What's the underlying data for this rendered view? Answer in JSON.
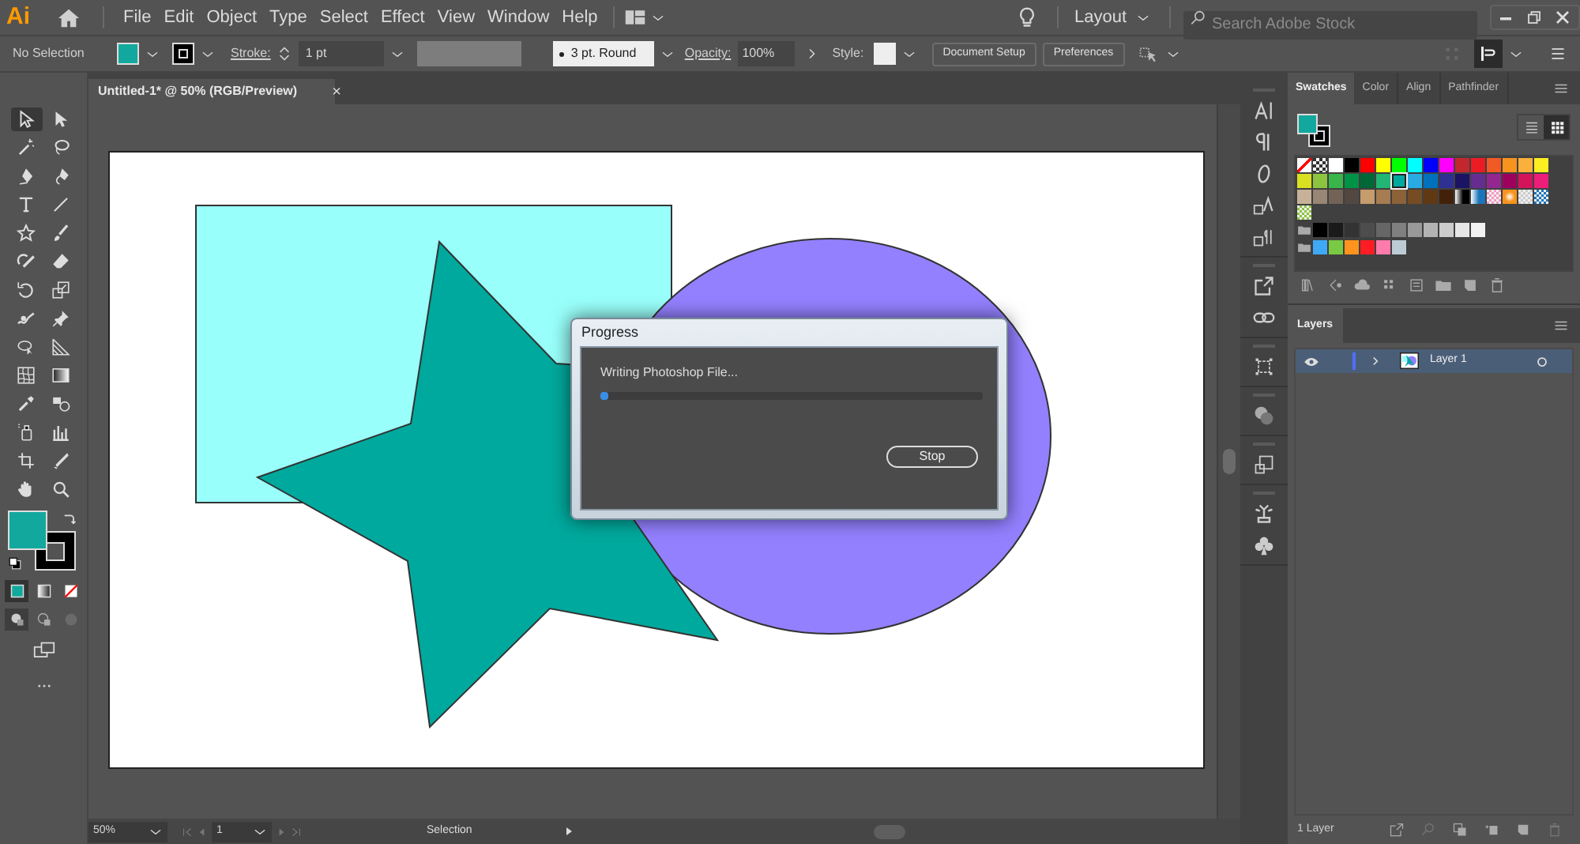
{
  "app": {
    "logo": "Ai"
  },
  "menu": [
    "File",
    "Edit",
    "Object",
    "Type",
    "Select",
    "Effect",
    "View",
    "Window",
    "Help"
  ],
  "workspace": {
    "label": "Layout"
  },
  "search": {
    "placeholder": "Search Adobe Stock"
  },
  "control_bar": {
    "selection": "No Selection",
    "stroke_label": "Stroke:",
    "stroke_weight": "1 pt",
    "brush": "3 pt. Round",
    "opacity_label": "Opacity:",
    "opacity": "100%",
    "style_label": "Style:",
    "buttons": [
      "Document Setup",
      "Preferences"
    ]
  },
  "document_tab": {
    "title": "Untitled-1* @ 50% (RGB/Preview)",
    "close": "×"
  },
  "tools": [
    {
      "selected": true
    },
    {
      "selected": false
    },
    {
      "selected": false
    },
    {
      "selected": false
    },
    {
      "selected": false
    },
    {
      "selected": false
    },
    {
      "selected": false
    },
    {
      "selected": false
    },
    {
      "selected": false
    },
    {
      "selected": false
    },
    {
      "selected": false
    },
    {
      "selected": false
    },
    {
      "selected": false
    },
    {
      "selected": false
    },
    {
      "selected": false
    },
    {
      "selected": false
    },
    {
      "selected": false
    },
    {
      "selected": false
    },
    {
      "selected": false
    },
    {
      "selected": false
    },
    {
      "selected": false
    },
    {
      "selected": false
    },
    {
      "selected": false
    },
    {
      "selected": false
    },
    {
      "selected": false
    },
    {
      "selected": false
    },
    {
      "selected": false
    },
    {
      "selected": false
    }
  ],
  "color_modes": [
    {
      "selected": true
    },
    {
      "selected": false
    },
    {
      "selected": false
    }
  ],
  "draw_modes": [
    {
      "selected": true
    },
    {
      "selected": false
    },
    {
      "selected": false
    }
  ],
  "artwork": [
    {
      "kind": "rectangle",
      "color": "#99fffa"
    },
    {
      "kind": "ellipse",
      "color": "#9380ff"
    },
    {
      "kind": "star",
      "color": "#00a99d"
    }
  ],
  "dialog": {
    "title": "Progress",
    "message": "Writing Photoshop File...",
    "level": 0.02,
    "button": "Stop"
  },
  "panel_tabs": [
    {
      "label": "Swatches",
      "selected": true
    },
    {
      "label": "Color",
      "selected": false
    },
    {
      "label": "Align",
      "selected": false
    },
    {
      "label": "Pathfinder",
      "selected": false
    }
  ],
  "swatch_views": [
    {
      "selected": false
    },
    {
      "selected": true
    }
  ],
  "swatch_rows": [
    {
      "group": false,
      "swatches": [
        {
          "kind": "none",
          "selected": false
        },
        {
          "kind": "registration",
          "selected": false
        },
        {
          "kind": "solid",
          "color": "#ffffff",
          "selected": false
        },
        {
          "kind": "solid",
          "color": "#000000",
          "selected": false
        },
        {
          "kind": "solid",
          "color": "#ff0000",
          "selected": false
        },
        {
          "kind": "solid",
          "color": "#ffff00",
          "selected": false
        },
        {
          "kind": "solid",
          "color": "#00ff00",
          "selected": false
        },
        {
          "kind": "solid",
          "color": "#00ffff",
          "selected": false
        },
        {
          "kind": "solid",
          "color": "#0000ff",
          "selected": false
        },
        {
          "kind": "solid",
          "color": "#ff00ff",
          "selected": false
        },
        {
          "kind": "solid",
          "color": "#c1272d",
          "selected": false
        },
        {
          "kind": "solid",
          "color": "#ed1c24",
          "selected": false
        },
        {
          "kind": "solid",
          "color": "#f15a24",
          "selected": false
        },
        {
          "kind": "solid",
          "color": "#f7931e",
          "selected": false
        },
        {
          "kind": "solid",
          "color": "#fbb03b",
          "selected": false
        },
        {
          "kind": "solid",
          "color": "#fcee21",
          "selected": false
        }
      ]
    },
    {
      "group": false,
      "swatches": [
        {
          "kind": "solid",
          "color": "#d9e021",
          "selected": false
        },
        {
          "kind": "solid",
          "color": "#8cc63f",
          "selected": false
        },
        {
          "kind": "solid",
          "color": "#39b54a",
          "selected": false
        },
        {
          "kind": "solid",
          "color": "#009245",
          "selected": false
        },
        {
          "kind": "solid",
          "color": "#006837",
          "selected": false
        },
        {
          "kind": "solid",
          "color": "#22b573",
          "selected": false
        },
        {
          "kind": "solid",
          "color": "#00a99d",
          "selected": true
        },
        {
          "kind": "solid",
          "color": "#29abe2",
          "selected": false
        },
        {
          "kind": "solid",
          "color": "#0071bc",
          "selected": false
        },
        {
          "kind": "solid",
          "color": "#2e3192",
          "selected": false
        },
        {
          "kind": "solid",
          "color": "#1b1464",
          "selected": false
        },
        {
          "kind": "solid",
          "color": "#662d91",
          "selected": false
        },
        {
          "kind": "solid",
          "color": "#93278f",
          "selected": false
        },
        {
          "kind": "solid",
          "color": "#9e005d",
          "selected": false
        },
        {
          "kind": "solid",
          "color": "#d4145a",
          "selected": false
        },
        {
          "kind": "solid",
          "color": "#ed1e79",
          "selected": false
        }
      ]
    },
    {
      "group": false,
      "swatches": [
        {
          "kind": "solid",
          "color": "#c7b299",
          "selected": false
        },
        {
          "kind": "solid",
          "color": "#998675",
          "selected": false
        },
        {
          "kind": "solid",
          "color": "#736357",
          "selected": false
        },
        {
          "kind": "solid",
          "color": "#534741",
          "selected": false
        },
        {
          "kind": "solid",
          "color": "#c69c6d",
          "selected": false
        },
        {
          "kind": "solid",
          "color": "#a67c52",
          "selected": false
        },
        {
          "kind": "solid",
          "color": "#8c6239",
          "selected": false
        },
        {
          "kind": "solid",
          "color": "#754c24",
          "selected": false
        },
        {
          "kind": "solid",
          "color": "#603813",
          "selected": false
        },
        {
          "kind": "solid",
          "color": "#42210b",
          "selected": false
        },
        {
          "kind": "gradient",
          "color": "#000000",
          "selected": false
        },
        {
          "kind": "gradient",
          "color": "#1b75bc",
          "selected": false
        },
        {
          "kind": "pattern",
          "color": "#f49ac1",
          "selected": false
        },
        {
          "kind": "radial",
          "color": "#f7941d",
          "selected": false
        },
        {
          "kind": "pattern",
          "color": "#cccccc",
          "selected": false
        },
        {
          "kind": "pattern",
          "color": "#1c75bc",
          "selected": false
        }
      ]
    },
    {
      "group": false,
      "swatches": [
        {
          "kind": "pattern",
          "color": "#8dc63f",
          "selected": false
        }
      ]
    },
    {
      "group": true,
      "swatches": [
        {
          "kind": "solid",
          "color": "#000000",
          "selected": false
        },
        {
          "kind": "solid",
          "color": "#1a1a1a",
          "selected": false
        },
        {
          "kind": "solid",
          "color": "#333333",
          "selected": false
        },
        {
          "kind": "solid",
          "color": "#4d4d4d",
          "selected": false
        },
        {
          "kind": "solid",
          "color": "#666666",
          "selected": false
        },
        {
          "kind": "solid",
          "color": "#808080",
          "selected": false
        },
        {
          "kind": "solid",
          "color": "#999999",
          "selected": false
        },
        {
          "kind": "solid",
          "color": "#b3b3b3",
          "selected": false
        },
        {
          "kind": "solid",
          "color": "#cccccc",
          "selected": false
        },
        {
          "kind": "solid",
          "color": "#e6e6e6",
          "selected": false
        },
        {
          "kind": "solid",
          "color": "#f2f2f2",
          "selected": false
        }
      ]
    },
    {
      "group": true,
      "swatches": [
        {
          "kind": "solid",
          "color": "#3fa9f5",
          "selected": false
        },
        {
          "kind": "solid",
          "color": "#7ac943",
          "selected": false
        },
        {
          "kind": "solid",
          "color": "#ff931e",
          "selected": false
        },
        {
          "kind": "solid",
          "color": "#ff1d25",
          "selected": false
        },
        {
          "kind": "solid",
          "color": "#ff7bac",
          "selected": false
        },
        {
          "kind": "solid",
          "color": "#bdccd4",
          "selected": false
        }
      ]
    }
  ],
  "layers_panel": {
    "tab": "Layers",
    "layers": [
      {
        "name": "Layer 1",
        "visible": true,
        "selected": true,
        "expanded": false,
        "color": "#4f6fff"
      }
    ],
    "count": "1 Layer"
  },
  "status_bar": {
    "zoom": "50%",
    "artboard": "1",
    "tool": "Selection"
  }
}
